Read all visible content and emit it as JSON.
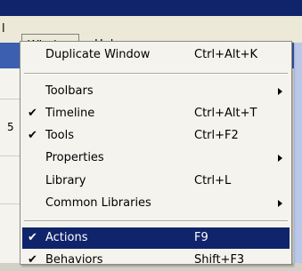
{
  "menubar": {
    "left_fragment": "l",
    "window_label": "Window",
    "help_label": "Help"
  },
  "background": {
    "side_number": "5"
  },
  "window_menu": {
    "items": [
      {
        "label": "Duplicate Window",
        "shortcut": "Ctrl+Alt+K",
        "checked": false,
        "submenu": false
      },
      {
        "label": "Toolbars",
        "shortcut": "",
        "checked": false,
        "submenu": true
      },
      {
        "label": "Timeline",
        "shortcut": "Ctrl+Alt+T",
        "checked": true,
        "submenu": false
      },
      {
        "label": "Tools",
        "shortcut": "Ctrl+F2",
        "checked": true,
        "submenu": false
      },
      {
        "label": "Properties",
        "shortcut": "",
        "checked": false,
        "submenu": true
      },
      {
        "label": "Library",
        "shortcut": "Ctrl+L",
        "checked": false,
        "submenu": false
      },
      {
        "label": "Common Libraries",
        "shortcut": "",
        "checked": false,
        "submenu": true
      },
      {
        "label": "Actions",
        "shortcut": "F9",
        "checked": true,
        "submenu": false,
        "highlighted": true
      },
      {
        "label": "Behaviors",
        "shortcut": "Shift+F3",
        "checked": true,
        "submenu": false
      }
    ],
    "check_glyph": "✔"
  },
  "colors": {
    "highlight": "#10246b",
    "menu_bg": "#f4f3ee"
  }
}
